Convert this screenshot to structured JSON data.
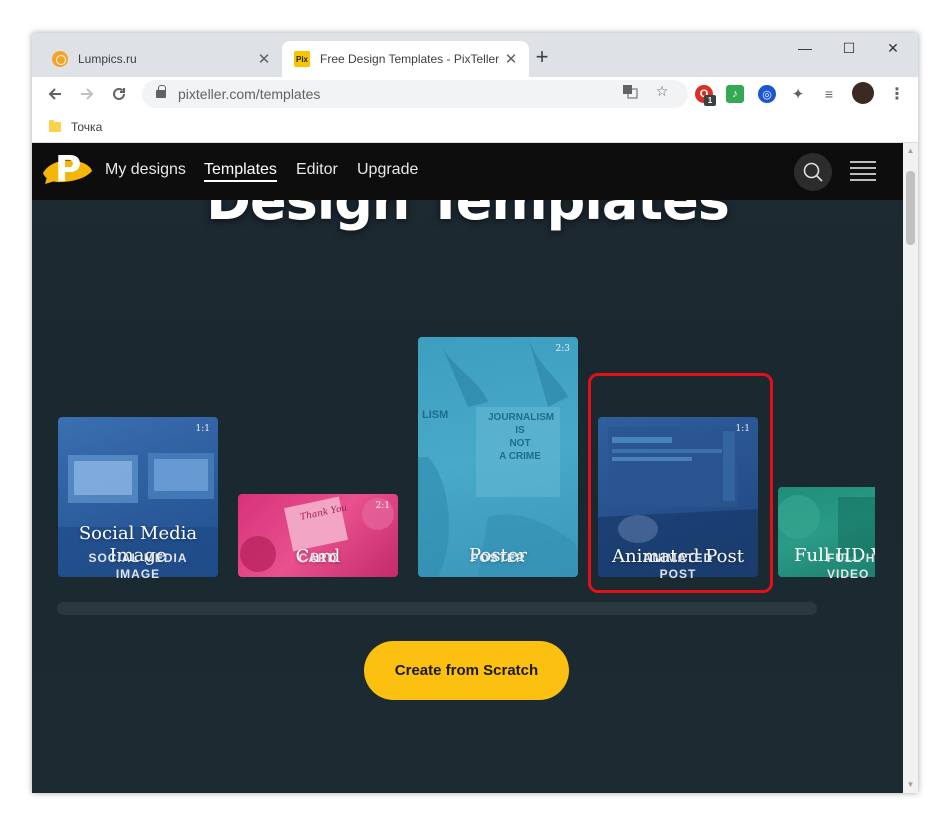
{
  "browser": {
    "tabs": [
      {
        "title": "Lumpics.ru",
        "favicon": "lumpics-orange-icon"
      },
      {
        "title": "Free Design Templates - PixTeller",
        "favicon": "pixteller-icon",
        "favicon_text": "Pix"
      }
    ],
    "new_tab_label": "+",
    "url": "pixteller.com/templates",
    "bookmarks": [
      {
        "label": "Точка"
      }
    ],
    "extension_badge": "1",
    "window_controls": {
      "minimize": "—",
      "maximize": "☐",
      "close": "✕"
    }
  },
  "site": {
    "logo_letter": "P",
    "nav": {
      "my_designs": "My designs",
      "templates": "Templates",
      "editor": "Editor",
      "upgrade": "Upgrade"
    },
    "hero_title": "Design Templates",
    "cards": [
      {
        "label_line1": "Social Media",
        "label_line2": "Image",
        "ratio": "1:1",
        "caption_line1": "SOCIAL MEDIA",
        "caption_line2": "IMAGE"
      },
      {
        "label_line1": "Card",
        "label_line2": "",
        "ratio": "2:1",
        "caption_line1": "CARD",
        "caption_line2": ""
      },
      {
        "label_line1": "Poster",
        "label_line2": "",
        "ratio": "2:3",
        "caption_line1": "POSTER",
        "caption_line2": ""
      },
      {
        "label_line1": "Animated Post",
        "label_line2": "",
        "ratio": "1:1",
        "caption_line1": "ANIMATED",
        "caption_line2": "POST"
      },
      {
        "label_line1": "Full HD V",
        "label_line2": "",
        "ratio": "",
        "caption_line1": "FULL H",
        "caption_line2": "VIDEO"
      }
    ],
    "poster_text": {
      "word1": "JOURNALISM",
      "word2": "IS",
      "word3": "NOT",
      "word4": "A CRIME",
      "side": "LISM"
    },
    "card_handwriting": "Thank You",
    "cta_label": "Create from Scratch"
  },
  "colors": {
    "accent_yellow": "#fcc010",
    "highlight_red": "#e3101a",
    "page_bg": "#1c2a31",
    "nav_bg": "#0d0d0d"
  }
}
